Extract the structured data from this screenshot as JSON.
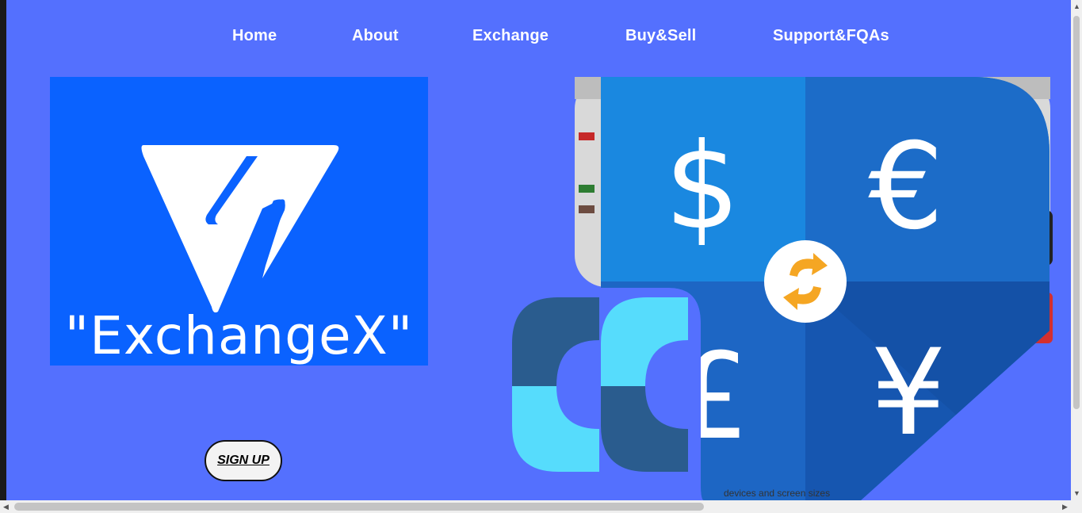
{
  "nav": {
    "items": [
      {
        "label": "Home"
      },
      {
        "label": "About"
      },
      {
        "label": "Exchange"
      },
      {
        "label": "Buy&Sell"
      },
      {
        "label": "Support&FQAs"
      }
    ]
  },
  "logo": {
    "text": "\"ExchangeX\"",
    "background": "#0a62ff"
  },
  "signup": {
    "label": "SIGN UP"
  },
  "hero": {
    "currency_symbols": [
      "$",
      "€",
      "£",
      "¥"
    ],
    "page_background": "#5470fe"
  }
}
